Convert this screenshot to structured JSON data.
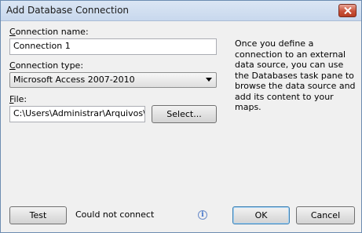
{
  "window": {
    "title": "Add Database Connection",
    "close_icon": "close-icon"
  },
  "form": {
    "connection_name": {
      "label_accel": "C",
      "label_rest": "onnection name:",
      "value": "Connection 1"
    },
    "connection_type": {
      "label_accel": "C",
      "label_rest": "onnection type:",
      "value": "Microsoft Access 2007-2010"
    },
    "file": {
      "label_accel": "F",
      "label_rest": "ile:",
      "value": "C:\\Users\\Administrar\\Arquivos\\Ban",
      "select_label": "Select..."
    }
  },
  "description": "Once you define a connection to an external data source, you can use the Databases task pane to browse the data source and add its content to your maps.",
  "footer": {
    "test_label": "Test",
    "status": "Could not connect",
    "info_icon": "info-icon",
    "ok_label": "OK",
    "cancel_label": "Cancel"
  },
  "colors": {
    "titlebar": "#c8d8ed",
    "close_button": "#c9523a",
    "dialog_bg": "#f0f0f0"
  }
}
